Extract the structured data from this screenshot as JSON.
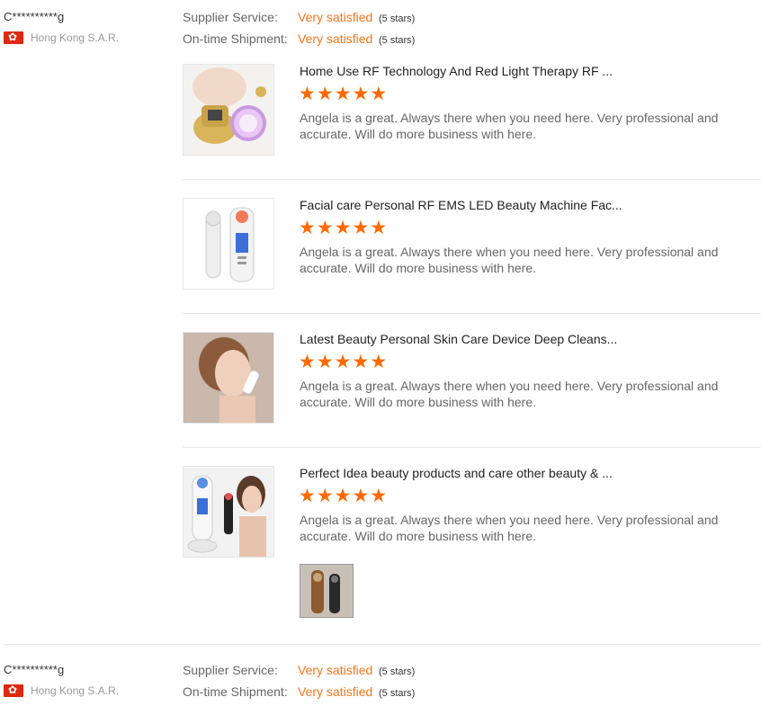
{
  "reviews": [
    {
      "name": "C**********g",
      "location": "Hong Kong S.A.R.",
      "flag_icon": "hong-kong-flag",
      "supplier_service_label": "Supplier Service:",
      "supplier_service_value": "Very satisfied",
      "supplier_service_stars": "(5 stars)",
      "shipment_label": "On-time Shipment:",
      "shipment_value": "Very satisfied",
      "shipment_stars": "(5 stars)",
      "products": [
        {
          "title": "Home Use RF Technology And Red Light Therapy RF ...",
          "rating": 5,
          "comment": "Angela is a great. Always there when you need here. Very professional and accurate. Will do more business with here."
        },
        {
          "title": "Facial care Personal RF EMS LED Beauty Machine Fac...",
          "rating": 5,
          "comment": "Angela is a great. Always there when you need here. Very professional and accurate. Will do more business with here."
        },
        {
          "title": "Latest Beauty Personal Skin Care Device Deep Cleans...",
          "rating": 5,
          "comment": "Angela is a great. Always there when you need here. Very professional and accurate. Will do more business with here."
        },
        {
          "title": "Perfect Idea beauty products and care other beauty & ...",
          "rating": 5,
          "comment": "Angela is a great. Always there when you need here. Very professional and accurate. Will do more business with here."
        }
      ]
    },
    {
      "name": "C**********g",
      "location": "Hong Kong S.A.R.",
      "flag_icon": "hong-kong-flag",
      "supplier_service_label": "Supplier Service:",
      "supplier_service_value": "Very satisfied",
      "supplier_service_stars": "(5 stars)",
      "shipment_label": "On-time Shipment:",
      "shipment_value": "Very satisfied",
      "shipment_stars": "(5 stars)"
    }
  ],
  "colors": {
    "accent": "#f7761a",
    "star": "#ff6a00",
    "flag": "#de2910"
  }
}
